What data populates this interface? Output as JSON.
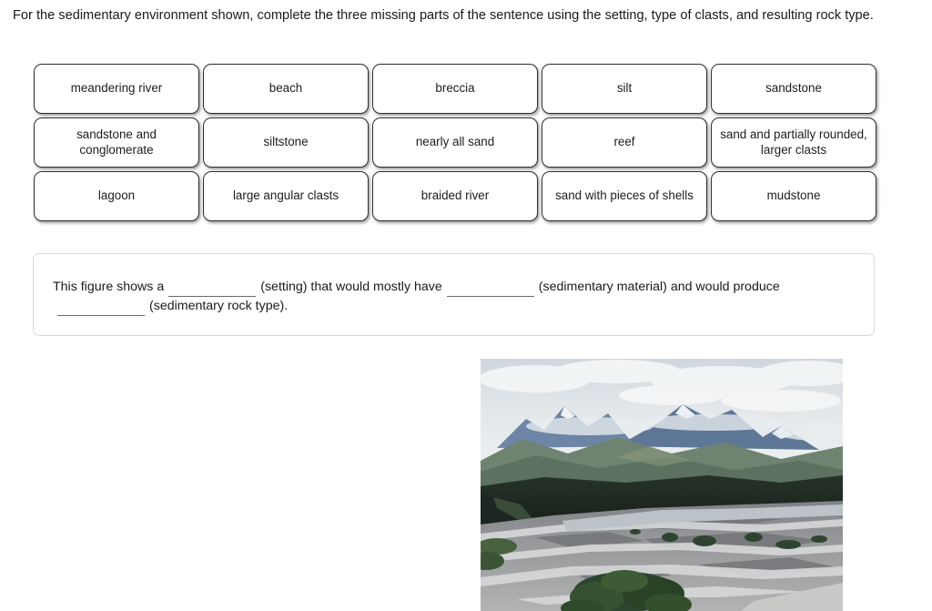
{
  "prompt": {
    "text": "For the sedimentary environment shown, complete the three missing parts of the sentence using the setting, type of clasts, and resulting rock type."
  },
  "word_bank": {
    "rows": [
      [
        {
          "label": "meandering river"
        },
        {
          "label": "beach"
        },
        {
          "label": "breccia"
        },
        {
          "label": "silt"
        },
        {
          "label": "sandstone"
        }
      ],
      [
        {
          "label": "sandstone and conglomerate"
        },
        {
          "label": "siltstone"
        },
        {
          "label": "nearly all sand"
        },
        {
          "label": "reef"
        },
        {
          "label": "sand and partially rounded, larger clasts"
        }
      ],
      [
        {
          "label": "lagoon"
        },
        {
          "label": "large angular clasts"
        },
        {
          "label": "braided river"
        },
        {
          "label": "sand with pieces of shells"
        },
        {
          "label": "mudstone"
        }
      ]
    ]
  },
  "sentence": {
    "segment_1": "This figure shows a",
    "blank_1_value": "",
    "segment_2": "(setting) that would mostly have",
    "blank_2_value": "",
    "segment_3": "(sedimentary material) and would produce",
    "blank_3_value": "",
    "segment_4": "(sedimentary rock type)."
  },
  "figure": {
    "description": "braided river valley with gravel bars, dark conifer forest, and snow-capped mountains under an overcast sky",
    "colors": {
      "sky": "#d7dce2",
      "cloud": "#f2f4f6",
      "far_peak": "#5d7493",
      "mid_ridge": "#7d8c7a",
      "forest": "#1f2b24",
      "gravel": "#9a9a98",
      "water": "#b9bec4"
    }
  }
}
